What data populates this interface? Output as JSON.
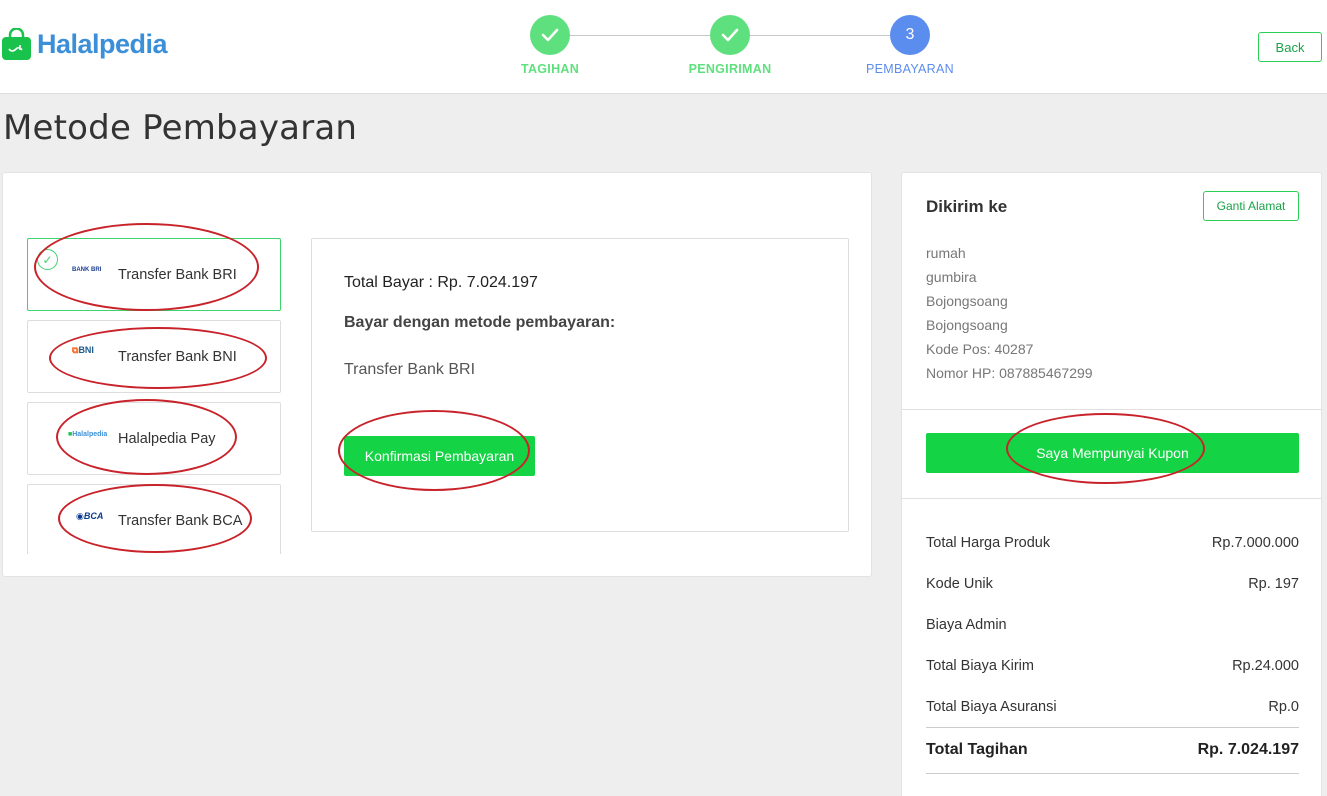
{
  "header": {
    "logo_text": "Halalpedia",
    "back_label": "Back",
    "steps": [
      {
        "label": "TAGIHAN",
        "state": "done"
      },
      {
        "label": "PENGIRIMAN",
        "state": "done"
      },
      {
        "label": "PEMBAYARAN",
        "state": "active",
        "number": "3"
      }
    ]
  },
  "page": {
    "title": "Metode Pembayaran"
  },
  "methods": [
    {
      "label": "Transfer Bank BRI",
      "logo": "BANK BRI",
      "selected": true
    },
    {
      "label": "Transfer Bank BNI",
      "logo": "BNI",
      "selected": false
    },
    {
      "label": "Halalpedia Pay",
      "logo": "Halalpedia",
      "selected": false
    },
    {
      "label": "Transfer Bank BCA",
      "logo": "BCA",
      "selected": false
    }
  ],
  "summary": {
    "total_bayar": "Total Bayar : Rp. 7.024.197",
    "bayar_dengan": "Bayar dengan metode pembayaran:",
    "method_chosen": "Transfer Bank BRI",
    "confirm_label": "Konfirmasi Pembayaran"
  },
  "shipping": {
    "title": "Dikirim ke",
    "change_label": "Ganti Alamat",
    "address_lines": [
      "rumah",
      "gumbira",
      "Bojongsoang",
      "Bojongsoang",
      "Kode Pos: 40287",
      "Nomor HP: 087885467299"
    ],
    "coupon_label": "Saya Mempunyai Kupon"
  },
  "costs": [
    {
      "label": "Total Harga Produk",
      "value": "Rp.7.000.000"
    },
    {
      "label": "Kode Unik",
      "value": "Rp. 197"
    },
    {
      "label": "Biaya Admin",
      "value": ""
    },
    {
      "label": "Total Biaya Kirim",
      "value": "Rp.24.000"
    },
    {
      "label": "Total Biaya Asuransi",
      "value": "Rp.0"
    }
  ],
  "total": {
    "label": "Total Tagihan",
    "value": "Rp. 7.024.197"
  },
  "colors": {
    "accent_green": "#14d344",
    "step_done": "#5fe07e",
    "step_active": "#5b8def",
    "annotation_red": "#c8232a",
    "logo_blue": "#3b8fd8"
  }
}
